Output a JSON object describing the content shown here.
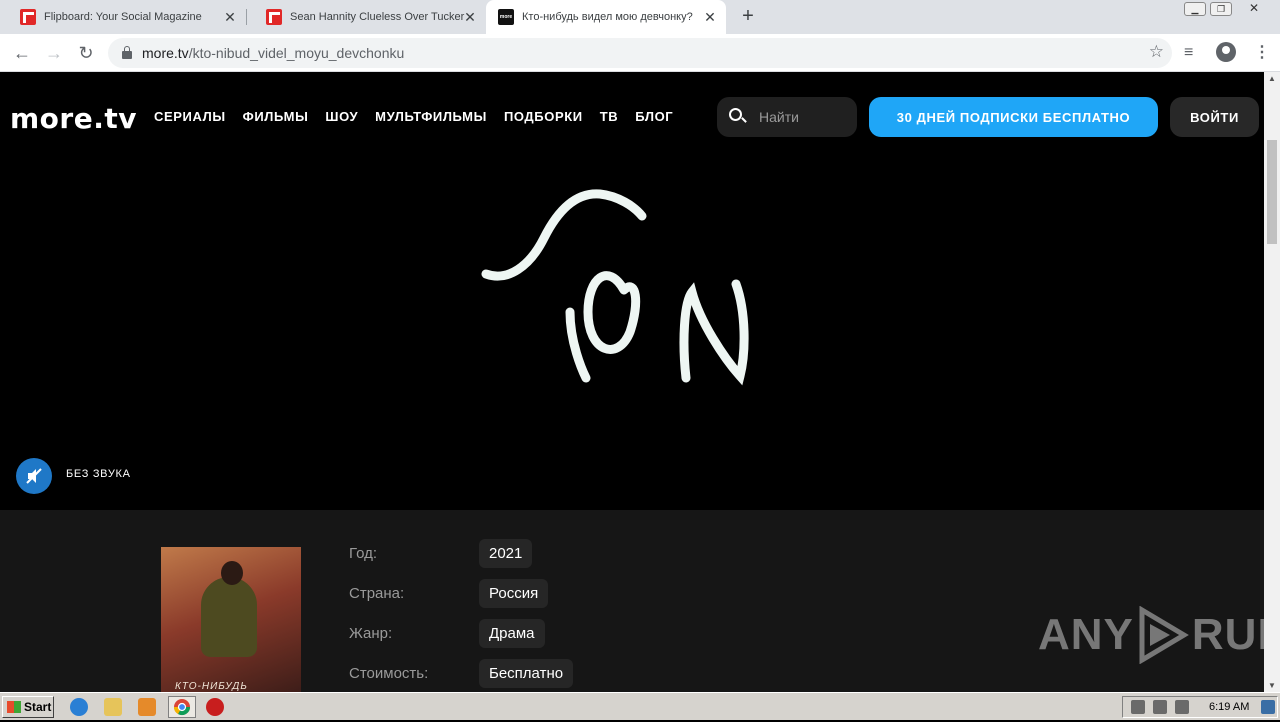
{
  "browser": {
    "tabs": [
      {
        "title": "Flipboard: Your Social Magazine",
        "favicon": "flipboard-icon"
      },
      {
        "title": "Sean Hannity Clueless Over Tucker C",
        "favicon": "flipboard-icon"
      },
      {
        "title": "Кто-нибудь видел мою девчонку?",
        "favicon": "more-tv-icon",
        "active": true
      }
    ],
    "favicon_more_text": "more",
    "url_host": "more.tv",
    "url_path": "/kto-nibud_videl_moyu_devchonku"
  },
  "site": {
    "logo": "more.tv",
    "nav": [
      "СЕРИАЛЫ",
      "ФИЛЬМЫ",
      "ШОУ",
      "МУЛЬТФИЛЬМЫ",
      "ПОДБОРКИ",
      "ТВ",
      "БЛОГ"
    ],
    "search_placeholder": "Найти",
    "promo_button": "30 ДНЕЙ ПОДПИСКИ БЕСПЛАТНО",
    "login_button": "ВОЙТИ",
    "accent_color": "#1fa6f7"
  },
  "hero": {
    "mute_label": "БЕЗ ЗВУКА"
  },
  "details": {
    "rows": [
      {
        "label": "Год:",
        "value": "2021"
      },
      {
        "label": "Страна:",
        "value": "Россия"
      },
      {
        "label": "Жанр:",
        "value": "Драма"
      },
      {
        "label": "Стоимость:",
        "value": "Бесплатно"
      }
    ],
    "poster_title": "КТО-НИБУДЬ"
  },
  "watermark": {
    "left": "ANY",
    "right": "RUN"
  },
  "taskbar": {
    "start_label": "Start",
    "clock": "6:19 AM"
  }
}
